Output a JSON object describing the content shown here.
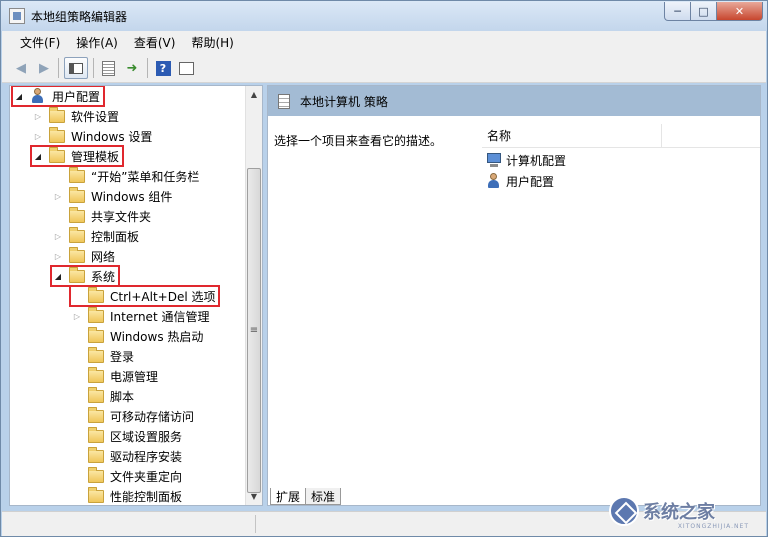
{
  "window": {
    "title": "本地组策略编辑器",
    "controls": {
      "minimize": "─",
      "maximize": "□",
      "close": "✕"
    }
  },
  "menu": [
    "文件(F)",
    "操作(A)",
    "查看(V)",
    "帮助(H)"
  ],
  "toolbar": {
    "help_glyph": "?"
  },
  "tree": [
    {
      "label": "用户配置",
      "icon": "user-config-icon",
      "toggle": "expanded",
      "highlighted": true
    },
    {
      "label": "软件设置",
      "icon": "folder-icon",
      "toggle": "collapsed"
    },
    {
      "label": "Windows 设置",
      "icon": "folder-icon",
      "toggle": "collapsed"
    },
    {
      "label": "管理模板",
      "icon": "folder-icon",
      "toggle": "expanded",
      "highlighted": true
    },
    {
      "label": "“开始”菜单和任务栏",
      "icon": "folder-icon",
      "toggle": "none"
    },
    {
      "label": "Windows 组件",
      "icon": "folder-icon",
      "toggle": "collapsed"
    },
    {
      "label": "共享文件夹",
      "icon": "folder-icon",
      "toggle": "none"
    },
    {
      "label": "控制面板",
      "icon": "folder-icon",
      "toggle": "collapsed"
    },
    {
      "label": "网络",
      "icon": "folder-icon",
      "toggle": "collapsed"
    },
    {
      "label": "系统",
      "icon": "folder-icon",
      "toggle": "expanded",
      "highlighted": true
    },
    {
      "label": "Ctrl+Alt+Del 选项",
      "icon": "folder-icon",
      "toggle": "none",
      "highlighted": true
    },
    {
      "label": "Internet 通信管理",
      "icon": "folder-icon",
      "toggle": "collapsed"
    },
    {
      "label": "Windows 热启动",
      "icon": "folder-icon",
      "toggle": "none"
    },
    {
      "label": "登录",
      "icon": "folder-icon",
      "toggle": "none"
    },
    {
      "label": "电源管理",
      "icon": "folder-icon",
      "toggle": "none"
    },
    {
      "label": "脚本",
      "icon": "folder-icon",
      "toggle": "none"
    },
    {
      "label": "可移动存储访问",
      "icon": "folder-icon",
      "toggle": "none"
    },
    {
      "label": "区域设置服务",
      "icon": "folder-icon",
      "toggle": "none"
    },
    {
      "label": "驱动程序安装",
      "icon": "folder-icon",
      "toggle": "none"
    },
    {
      "label": "文件夹重定向",
      "icon": "folder-icon",
      "toggle": "none"
    },
    {
      "label": "性能控制面板",
      "icon": "folder-icon",
      "toggle": "none"
    }
  ],
  "highlight_color": "#e0282e",
  "details": {
    "header": "本地计算机 策略",
    "description": "选择一个项目来查看它的描述。",
    "column_name": "名称",
    "items": [
      {
        "label": "计算机配置",
        "icon": "computer-config-icon"
      },
      {
        "label": "用户配置",
        "icon": "user-config-icon"
      }
    ],
    "tabs": [
      "扩展",
      "标准"
    ]
  },
  "watermark": {
    "text": "系统之家",
    "sub": "XITONGZHIJIA.NET"
  }
}
